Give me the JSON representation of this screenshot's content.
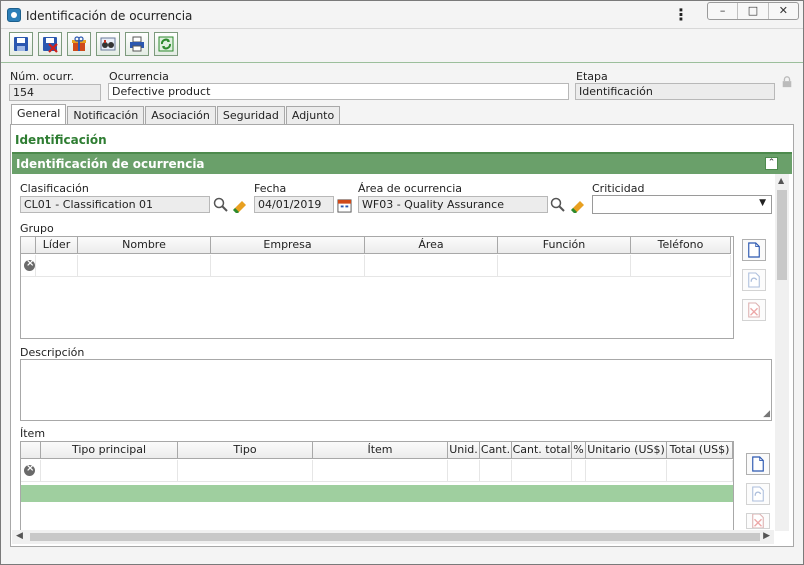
{
  "window": {
    "title": "Identificación de ocurrencia",
    "controls": [
      "–",
      "□",
      "✕"
    ]
  },
  "toolbar": {
    "buttons": [
      {
        "name": "save-button",
        "icon": "save-icon"
      },
      {
        "name": "save-close-button",
        "icon": "save-close-icon"
      },
      {
        "name": "gift-button",
        "icon": "gift-icon"
      },
      {
        "name": "search-people-button",
        "icon": "binoculars-icon"
      },
      {
        "name": "print-button",
        "icon": "printer-icon"
      },
      {
        "name": "refresh-button",
        "icon": "refresh-icon"
      }
    ]
  },
  "header": {
    "num_label": "Núm. ocurr.",
    "num_value": "154",
    "occurrence_label": "Ocurrencia",
    "occurrence_value": "Defective product",
    "stage_label": "Etapa",
    "stage_value": "Identificación"
  },
  "tabs": [
    "General",
    "Notificación",
    "Asociación",
    "Seguridad",
    "Adjunto"
  ],
  "active_tab": "General",
  "section": {
    "heading": "Identificación",
    "panel_title": "Identificación de ocurrencia"
  },
  "form": {
    "classification_label": "Clasificación",
    "classification_value": "CL01 - Classification 01",
    "date_label": "Fecha",
    "date_value": "04/01/2019",
    "area_label": "Área de ocurrencia",
    "area_value": "WF03 - Quality Assurance",
    "criticality_label": "Criticidad",
    "criticality_value": ""
  },
  "group": {
    "label": "Grupo",
    "columns": [
      "",
      "Líder",
      "Nombre",
      "Empresa",
      "Área",
      "Función",
      "Teléfono"
    ]
  },
  "description": {
    "label": "Descripción",
    "value": ""
  },
  "items": {
    "label": "Ítem",
    "columns": [
      "",
      "Tipo principal",
      "Tipo",
      "Ítem",
      "Unid.",
      "Cant.",
      "Cant. total",
      "%",
      "Unitario (US$)",
      "Total (US$)"
    ]
  },
  "colors": {
    "accent": "#6aa06a",
    "heading": "#2e7d32",
    "highlight_row": "#9fcf9f"
  }
}
